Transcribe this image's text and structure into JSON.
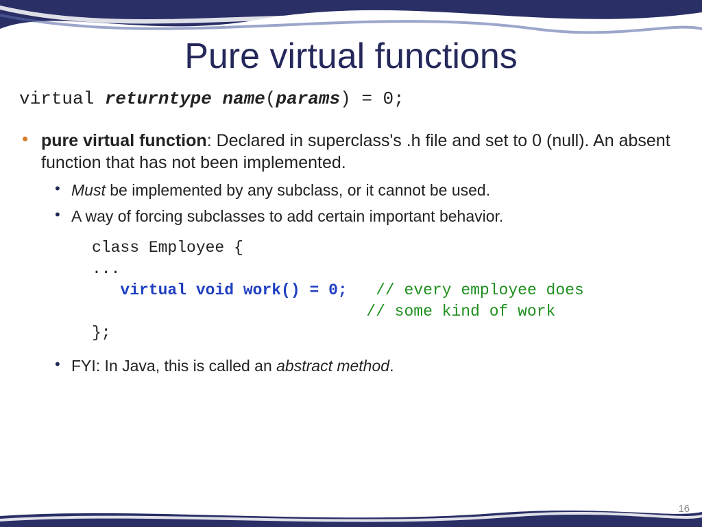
{
  "title": "Pure virtual functions",
  "decl": {
    "kw": "virtual ",
    "rt": "returntype",
    "sp1": " ",
    "nm": "name",
    "paren_open": "(",
    "pm": "params",
    "tail": ") = 0;"
  },
  "bullet1": {
    "term": "pure virtual function",
    "rest": ": Declared in superclass's .h file and set to 0 (null).  An absent function that has not been implemented."
  },
  "sub": {
    "a_ital": "Must",
    "a_rest": " be implemented by any subclass, or it cannot be used.",
    "b": "A way of forcing subclasses to add certain important behavior.",
    "c_pre": "FYI: In Java, this is called an ",
    "c_ital": "abstract method",
    "c_post": "."
  },
  "code": {
    "l1": "class Employee {",
    "l2": "...",
    "l3_indent": "   ",
    "l3_kw": "virtual void work() = 0;",
    "l3_gap": "   ",
    "l3_c": "// every employee does",
    "l4_indent": "                             ",
    "l4_c": "// some kind of work",
    "l5": "};"
  },
  "pagenum": "16"
}
